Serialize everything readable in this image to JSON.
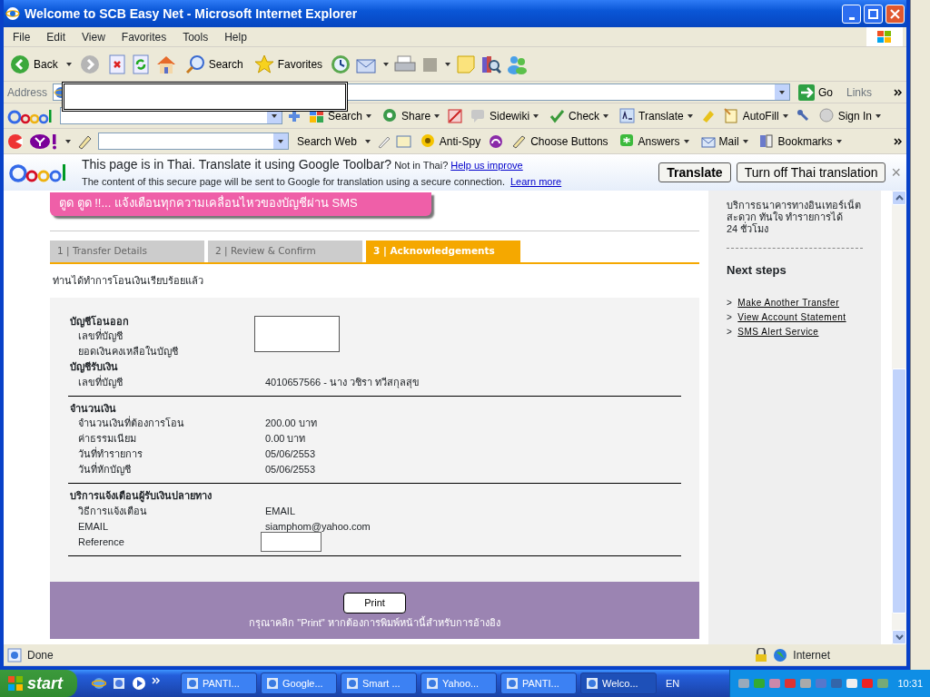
{
  "window": {
    "title": "Welcome to SCB Easy Net - Microsoft Internet Explorer"
  },
  "menu": [
    "File",
    "Edit",
    "View",
    "Favorites",
    "Tools",
    "Help"
  ],
  "toolbar": {
    "back": "Back",
    "search": "Search",
    "favorites": "Favorites"
  },
  "address_bar": {
    "label": "Address",
    "go": "Go",
    "links": "Links"
  },
  "google_toolbar": {
    "items": [
      "Search",
      "Share",
      "Sidewiki",
      "Check",
      "Translate",
      "AutoFill",
      "Sign In"
    ]
  },
  "yahoo_toolbar": {
    "search_button": "Search Web",
    "items": [
      "Anti-Spy",
      "Choose Buttons",
      "Answers",
      "Mail",
      "Bookmarks"
    ]
  },
  "translate_bar": {
    "message": "This page is in Thai.  Translate it using Google Toolbar?",
    "not_in": "Not in Thai?",
    "help_link": "Help us improve",
    "note": "The content of this secure page will be sent to Google for translation using a secure connection.",
    "learn_more": "Learn more",
    "buttons": [
      "Translate",
      "Turn off Thai translation"
    ],
    "close": "×"
  },
  "page": {
    "banner": "ตูด ตูด !!... แจ้งเตือนทุกความเคลื่อนไหวของบัญชีผ่าน SMS",
    "steps": [
      {
        "label": "1 | Transfer Details",
        "selected": false
      },
      {
        "label": "2 | Review & Confirm",
        "selected": false
      },
      {
        "label": "3 | Acknowledgements",
        "selected": true
      }
    ],
    "message": "ท่านได้ทำการโอนเงินเรียบร้อยแล้ว",
    "sections": [
      {
        "groups": [
          {
            "heading": "บัญชีโอนออก",
            "kind": "masked",
            "rows": [
              {
                "label": "เลขที่บัญชี"
              },
              {
                "label": "ยอดเงินคงเหลือในบัญชี"
              }
            ]
          },
          {
            "heading": "บัญชีรับเงิน",
            "kind": "plain",
            "rows": [
              {
                "label": "เลขที่บัญชี",
                "value": "4010657566 - นาง วชิรา ทวีสกุลสุข"
              }
            ]
          }
        ]
      },
      {
        "groups": [
          {
            "heading": "จำนวนเงิน",
            "kind": "plain",
            "rows": [
              {
                "label": "จำนวนเงินที่ต้องการโอน",
                "value": "200.00 บาท"
              },
              {
                "label": "ค่าธรรมเนียม",
                "value": "0.00 บาท"
              },
              {
                "label": "วันที่ทำรายการ",
                "value": "05/06/2553"
              },
              {
                "label": "วันที่หักบัญชี",
                "value": "05/06/2553"
              }
            ]
          }
        ]
      },
      {
        "groups": [
          {
            "heading": "บริการแจ้งเตือนผู้รับเงินปลายทาง",
            "kind": "plain",
            "rows": [
              {
                "label": "วิธีการแจ้งเตือน",
                "value": "EMAIL"
              },
              {
                "label": "EMAIL",
                "value": "siamphom@yahoo.com"
              },
              {
                "label": "Reference",
                "kind": "field"
              }
            ]
          }
        ]
      }
    ],
    "print_button": "Print",
    "print_note": "กรุณาคลิก \"Print\" หากต้องการพิมพ์หน้านี้สำหรับการอ้างอิง"
  },
  "sidebar": {
    "promo": "บริการธนาคารทางอินเทอร์เน็ต\nสะดวก ทันใจ ทำรายการได้\n24 ชั่วโมง",
    "next_steps_title": "Next steps",
    "links": [
      {
        "marker": ">",
        "label": "Make Another Transfer"
      },
      {
        "marker": ">",
        "label": "View Account Statement"
      },
      {
        "marker": ">",
        "label": "SMS Alert Service"
      }
    ]
  },
  "status_bar": {
    "text": "Done",
    "zone": "Internet"
  },
  "taskbar": {
    "start": "start",
    "tasks": [
      {
        "label": "PANTI...",
        "selected": false
      },
      {
        "label": "Google...",
        "selected": false
      },
      {
        "label": "Smart ...",
        "selected": false
      },
      {
        "label": "Yahoo...",
        "selected": false
      },
      {
        "label": "PANTI...",
        "selected": false
      },
      {
        "label": "Welco...",
        "selected": true
      }
    ],
    "language": "EN",
    "clock": "10:31"
  }
}
